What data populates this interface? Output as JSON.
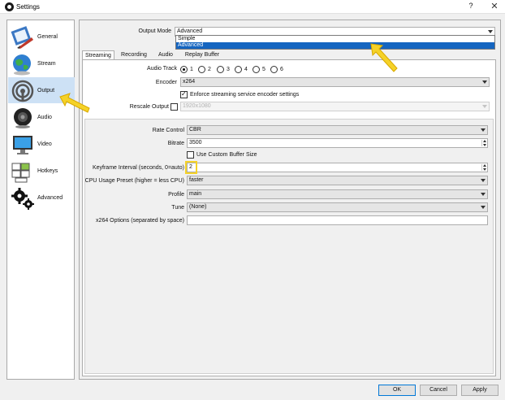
{
  "window": {
    "title": "Settings",
    "help": "?",
    "close": "✕"
  },
  "sidebar": {
    "items": [
      {
        "label": "General",
        "icon": "general-icon"
      },
      {
        "label": "Stream",
        "icon": "stream-globe-icon"
      },
      {
        "label": "Output",
        "icon": "output-broadcast-icon",
        "active": true
      },
      {
        "label": "Audio",
        "icon": "speaker-icon"
      },
      {
        "label": "Video",
        "icon": "monitor-icon"
      },
      {
        "label": "Hotkeys",
        "icon": "keyboard-icon"
      },
      {
        "label": "Advanced",
        "icon": "gears-icon"
      }
    ]
  },
  "output_mode": {
    "label": "Output Mode",
    "value": "Advanced",
    "options": [
      "Simple",
      "Advanced"
    ],
    "selected_option": "Advanced"
  },
  "tabs": [
    "Streaming",
    "Recording",
    "Audio",
    "Replay Buffer"
  ],
  "active_tab": "Streaming",
  "streaming": {
    "audio_track_label": "Audio Track",
    "audio_tracks": [
      "1",
      "2",
      "3",
      "4",
      "5",
      "6"
    ],
    "audio_track_selected": "1",
    "encoder_label": "Encoder",
    "encoder_value": "x264",
    "enforce_label": "Enforce streaming service encoder settings",
    "enforce_checked": true,
    "rescale_label": "Rescale Output",
    "rescale_checked": false,
    "rescale_value": "1920x1080",
    "rate_control_label": "Rate Control",
    "rate_control_value": "CBR",
    "bitrate_label": "Bitrate",
    "bitrate_value": "3500",
    "custom_buffer_label": "Use Custom Buffer Size",
    "custom_buffer_checked": false,
    "keyframe_label": "Keyframe Interval (seconds, 0=auto)",
    "keyframe_value": "2",
    "cpu_preset_label": "CPU Usage Preset (higher = less CPU)",
    "cpu_preset_value": "faster",
    "profile_label": "Profile",
    "profile_value": "main",
    "tune_label": "Tune",
    "tune_value": "(None)",
    "x264_options_label": "x264 Options (separated by space)",
    "x264_options_value": ""
  },
  "buttons": {
    "ok": "OK",
    "cancel": "Cancel",
    "apply": "Apply"
  },
  "colors": {
    "highlight": "#f5d228",
    "selection": "#1565c0",
    "active_nav": "#cde1f5"
  }
}
